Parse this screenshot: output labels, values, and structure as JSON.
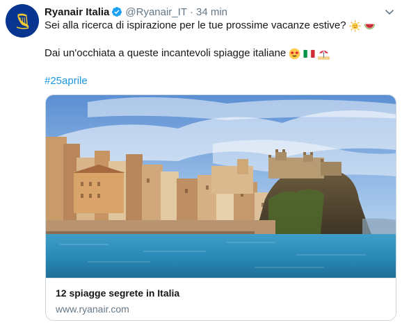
{
  "tweet": {
    "author_name": "Ryanair Italia",
    "handle": "@Ryanair_IT",
    "separator": "·",
    "time": "34 min",
    "text_line1": "Sei alla ricerca di ispirazione per le tue prossime vacanze estive?",
    "text_line2": "Dai un'occhiata a queste incantevoli spiagge italiane",
    "hashtag": "#25aprile"
  },
  "card": {
    "title": "12 spiagge segrete in Italia",
    "domain": "www.ryanair.com"
  },
  "icons": {
    "avatar": "ryanair-harp-logo",
    "verified": "verified-badge-icon",
    "caret": "chevron-down-icon",
    "emojis": [
      "sun-emoji",
      "watermelon-emoji",
      "star-struck-emoji",
      "italy-flag-emoji",
      "beach-umbrella-emoji"
    ]
  },
  "colors": {
    "brand_blue": "#073590",
    "brand_yellow": "#f1c933",
    "link": "#1b95e0",
    "secondary_text": "#657786",
    "verified": "#1da1f2"
  }
}
